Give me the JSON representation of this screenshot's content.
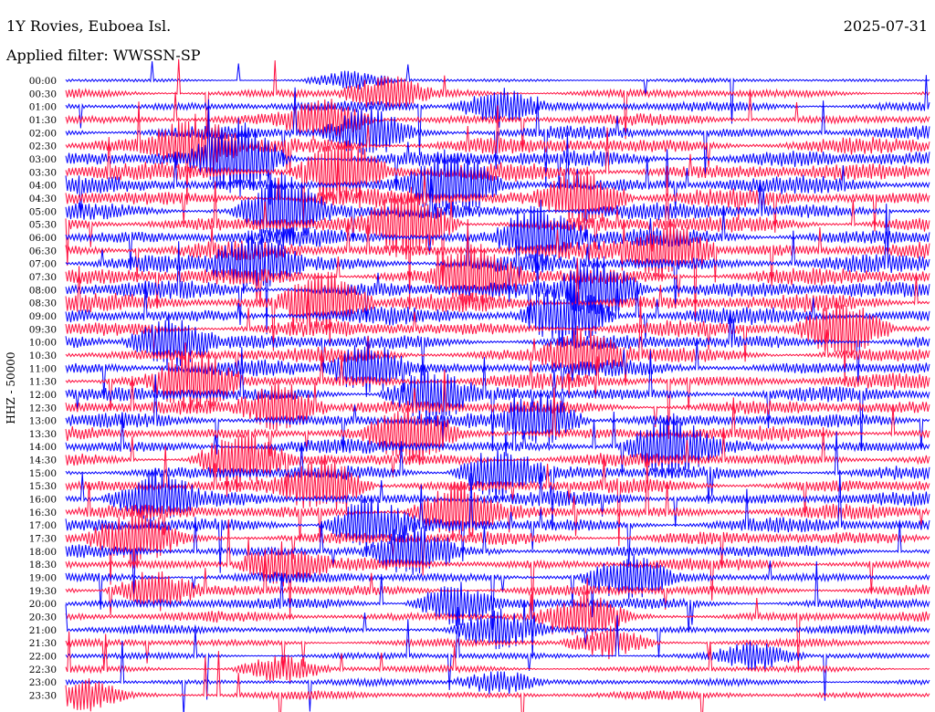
{
  "header": {
    "station": "1Y Rovies, Euboea Isl.",
    "date": "2025-07-31",
    "filter": "Applied filter: WWSSN-SP"
  },
  "channel_label": "HHZ - 50000",
  "colors": {
    "trace_a": "#0000ff",
    "trace_b": "#ff1040",
    "background": "#ffffff",
    "text": "#000000"
  },
  "chart_data": {
    "type": "line",
    "title": "",
    "ylabel": "HHZ - 50000",
    "xlabel": "",
    "grid": false,
    "series_colors_alternate": [
      "#0000ff",
      "#ff1040"
    ],
    "rows": [
      {
        "label": "00:00",
        "activity": 0.12,
        "burst_at": 0.33
      },
      {
        "label": "00:30",
        "activity": 0.45,
        "burst_at": 0.37
      },
      {
        "label": "01:00",
        "activity": 0.55,
        "burst_at": 0.5
      },
      {
        "label": "01:30",
        "activity": 0.6,
        "burst_at": 0.3
      },
      {
        "label": "02:00",
        "activity": 0.7,
        "burst_at": 0.35
      },
      {
        "label": "02:30",
        "activity": 0.95,
        "burst_at": 0.15
      },
      {
        "label": "03:00",
        "activity": 1.0,
        "burst_at": 0.2
      },
      {
        "label": "03:30",
        "activity": 1.0,
        "burst_at": 0.32
      },
      {
        "label": "04:00",
        "activity": 1.0,
        "burst_at": 0.45
      },
      {
        "label": "04:30",
        "activity": 1.0,
        "burst_at": 0.6
      },
      {
        "label": "05:00",
        "activity": 1.0,
        "burst_at": 0.25
      },
      {
        "label": "05:30",
        "activity": 1.0,
        "burst_at": 0.4
      },
      {
        "label": "06:00",
        "activity": 1.0,
        "burst_at": 0.55
      },
      {
        "label": "06:30",
        "activity": 1.0,
        "burst_at": 0.7
      },
      {
        "label": "07:00",
        "activity": 1.0,
        "burst_at": 0.22
      },
      {
        "label": "07:30",
        "activity": 1.0,
        "burst_at": 0.48
      },
      {
        "label": "08:00",
        "activity": 1.0,
        "burst_at": 0.62
      },
      {
        "label": "08:30",
        "activity": 1.0,
        "burst_at": 0.3
      },
      {
        "label": "09:00",
        "activity": 0.95,
        "burst_at": 0.58
      },
      {
        "label": "09:30",
        "activity": 0.9,
        "burst_at": 0.9
      },
      {
        "label": "10:00",
        "activity": 0.85,
        "burst_at": 0.12
      },
      {
        "label": "10:30",
        "activity": 0.85,
        "burst_at": 0.6
      },
      {
        "label": "11:00",
        "activity": 0.85,
        "burst_at": 0.35
      },
      {
        "label": "11:30",
        "activity": 0.85,
        "burst_at": 0.15
      },
      {
        "label": "12:00",
        "activity": 0.8,
        "burst_at": 0.42
      },
      {
        "label": "12:30",
        "activity": 0.8,
        "burst_at": 0.25
      },
      {
        "label": "13:00",
        "activity": 0.8,
        "burst_at": 0.55
      },
      {
        "label": "13:30",
        "activity": 0.8,
        "burst_at": 0.4
      },
      {
        "label": "14:00",
        "activity": 0.8,
        "burst_at": 0.7
      },
      {
        "label": "14:30",
        "activity": 0.8,
        "burst_at": 0.2
      },
      {
        "label": "15:00",
        "activity": 0.8,
        "burst_at": 0.5
      },
      {
        "label": "15:30",
        "activity": 0.8,
        "burst_at": 0.3
      },
      {
        "label": "16:00",
        "activity": 0.8,
        "burst_at": 0.1
      },
      {
        "label": "16:30",
        "activity": 0.8,
        "burst_at": 0.45
      },
      {
        "label": "17:00",
        "activity": 0.8,
        "burst_at": 0.35
      },
      {
        "label": "17:30",
        "activity": 0.75,
        "burst_at": 0.08
      },
      {
        "label": "18:00",
        "activity": 0.7,
        "burst_at": 0.4
      },
      {
        "label": "18:30",
        "activity": 0.65,
        "burst_at": 0.25
      },
      {
        "label": "19:00",
        "activity": 0.6,
        "burst_at": 0.65
      },
      {
        "label": "19:30",
        "activity": 0.6,
        "burst_at": 0.1
      },
      {
        "label": "20:00",
        "activity": 0.6,
        "burst_at": 0.45
      },
      {
        "label": "20:30",
        "activity": 0.55,
        "burst_at": 0.6
      },
      {
        "label": "21:00",
        "activity": 0.45,
        "burst_at": 0.5
      },
      {
        "label": "21:30",
        "activity": 0.35,
        "burst_at": 0.63
      },
      {
        "label": "22:00",
        "activity": 0.3,
        "burst_at": 0.8
      },
      {
        "label": "22:30",
        "activity": 0.3,
        "burst_at": 0.25
      },
      {
        "label": "23:00",
        "activity": 0.3,
        "burst_at": 0.5
      },
      {
        "label": "23:30",
        "activity": 0.4,
        "burst_at": 0.02
      }
    ]
  }
}
